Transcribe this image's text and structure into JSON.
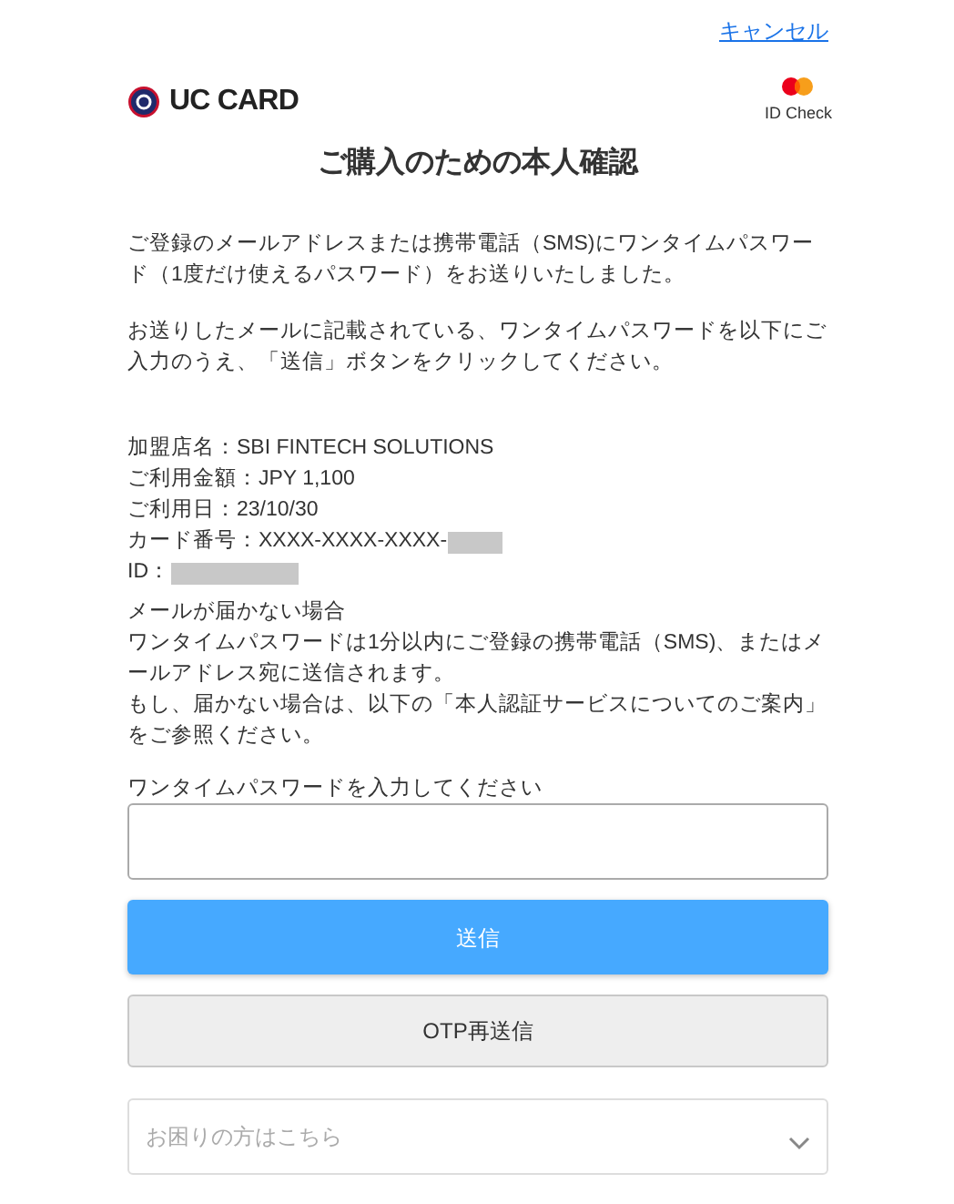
{
  "cancel_link": "キャンセル",
  "brand": {
    "logo_text": "UC CARD",
    "badge_text": "ID Check"
  },
  "title": "ご購入のための本人確認",
  "paragraphs": [
    "ご登録のメールアドレスまたは携帯電話（SMS)にワンタイムパスワード（1度だけ使えるパスワード）をお送りいたしました。",
    "お送りしたメールに記載されている、ワンタイムパスワードを以下にご入力のうえ、「送信」ボタンをクリックしてください。"
  ],
  "details": [
    {
      "label": "加盟店名：",
      "value": "SBI FINTECH SOLUTIONS",
      "redacted": false
    },
    {
      "label": "ご利用金額：",
      "value": "JPY 1,100",
      "redacted": false
    },
    {
      "label": "ご利用日：",
      "value": "23/10/30",
      "redacted": false
    },
    {
      "label": "カード番号：",
      "value": "XXXX-XXXX-XXXX-",
      "redacted": true
    },
    {
      "label": "ID：",
      "redacted": true
    }
  ],
  "help_text": [
    "メールが届かない場合",
    "ワンタイムパスワードは1分以内にご登録の携帯電話（SMS)、またはメールアドレス宛に送信されます。",
    "もし、届かない場合は、以下の「本人認証サービスについてのご案内」をご参照ください。"
  ],
  "otp_field": {
    "label": "ワンタイムパスワードを入力してください"
  },
  "buttons": [
    {
      "label": "送信",
      "kind": "primary"
    },
    {
      "label": "OTP再送信",
      "kind": "secondary"
    }
  ],
  "help_dropdown": {
    "placeholder": "お困りの方はこちら"
  }
}
